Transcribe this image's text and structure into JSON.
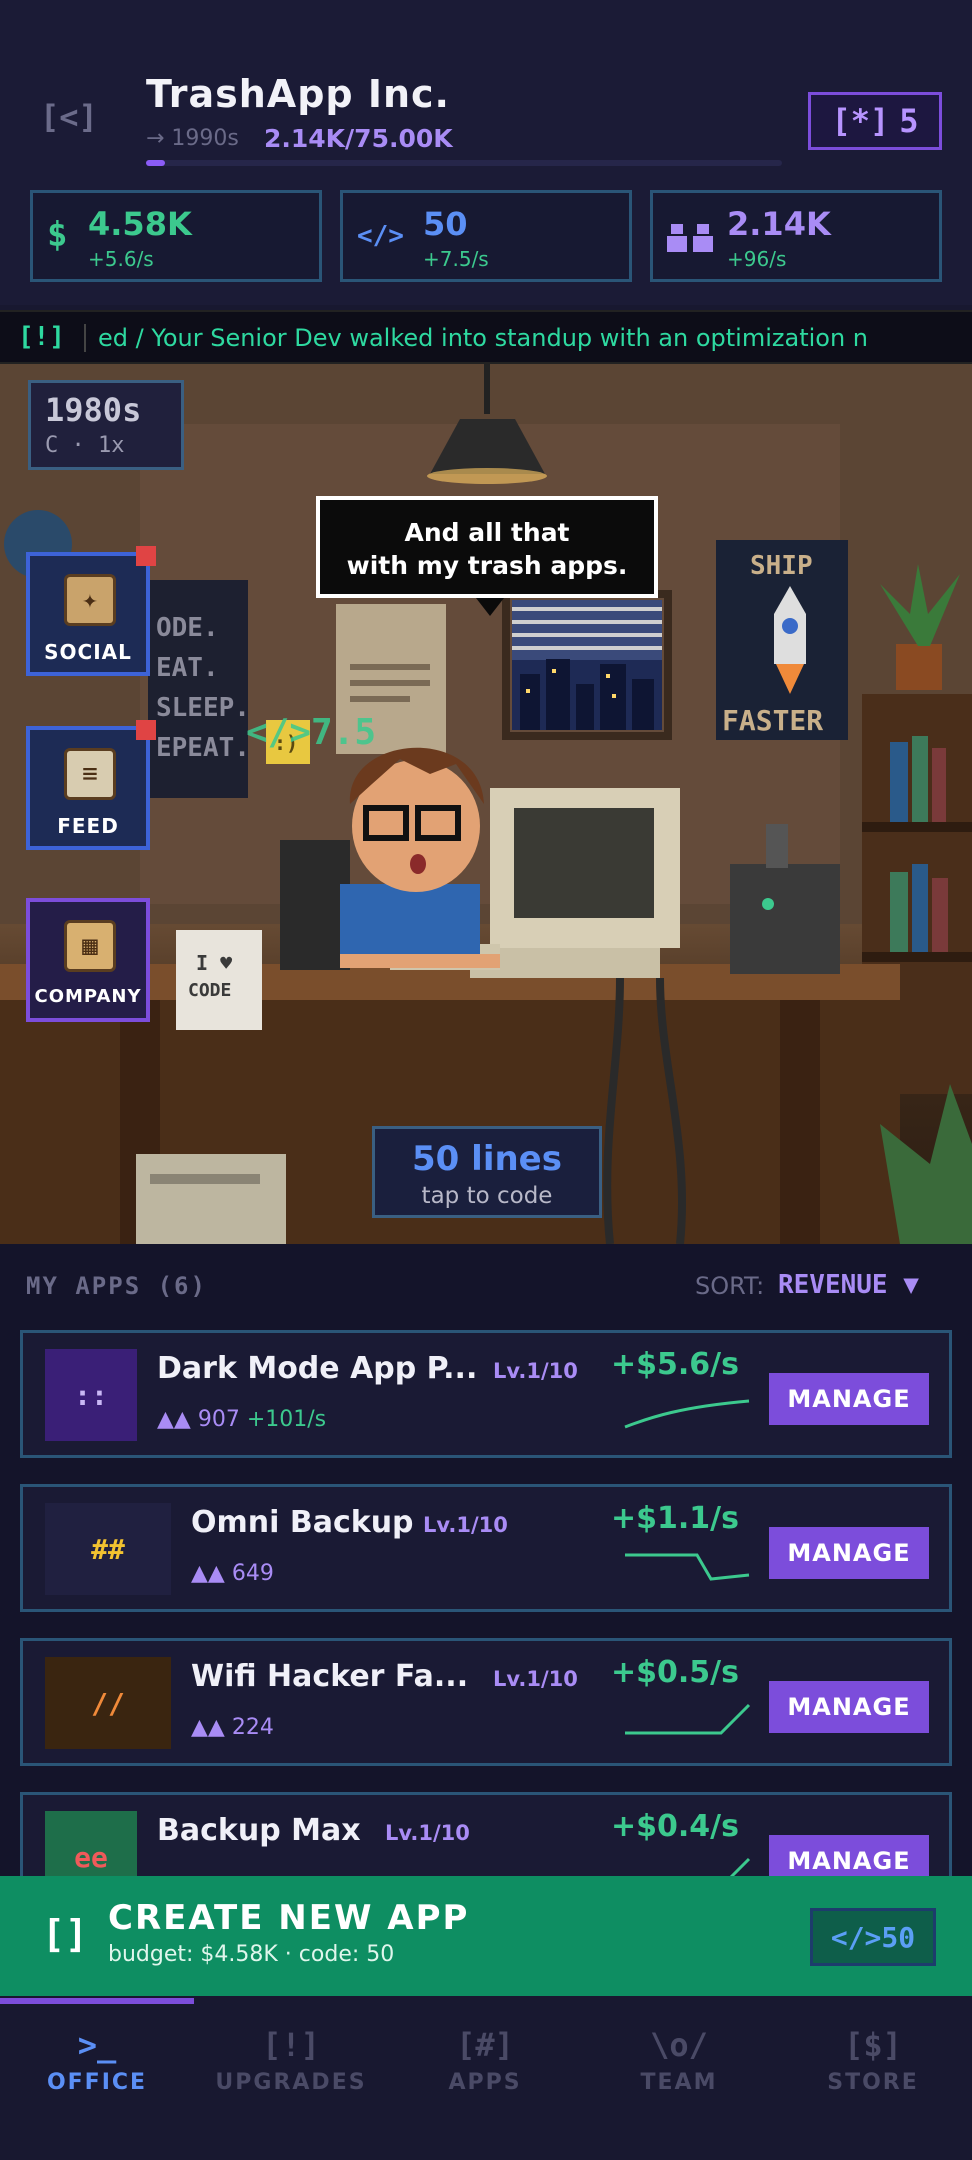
{
  "header": {
    "back_label": "[<]",
    "company_name": "TrashApp Inc.",
    "era_hint": "→ 1990s",
    "users_progress": "2.14K/75.00K",
    "progress_fraction": 0.03,
    "token_icon": "[*]",
    "token_count": "5"
  },
  "stats": [
    {
      "icon": "$",
      "value": "4.58K",
      "rate": "+5.6/s",
      "color": "#3cc98e"
    },
    {
      "icon": "</>",
      "value": "50",
      "rate": "+7.5/s",
      "color": "#5b8ff5"
    },
    {
      "icon": "users-icon",
      "value": "2.14K",
      "rate": "+96/s",
      "color": "#a98cf5"
    }
  ],
  "ticker": {
    "tag": "[!]",
    "text": "ed  /  Your Senior Dev walked into standup with an optimization n"
  },
  "scene": {
    "era_title": "1980s",
    "era_sub": "C · 1x",
    "speech_line1": "And all that",
    "speech_line2": "with my trash apps.",
    "floater": "</>7.5",
    "side_buttons": [
      {
        "label": "SOCIAL",
        "icon": "social-icon",
        "has_notification": true
      },
      {
        "label": "FEED",
        "icon": "newspaper-icon",
        "has_notification": true
      },
      {
        "label": "COMPANY",
        "icon": "company-building-icon",
        "has_notification": false
      }
    ],
    "code_button_main": "50 lines",
    "code_button_sub": "tap to code"
  },
  "apps": {
    "title": "MY APPS (6)",
    "sort_label": "SORT:",
    "sort_value": "REVENUE ▼",
    "items": [
      {
        "icon_text": "::",
        "icon_bg": "#3a1f77",
        "icon_color": "#c9b8f5",
        "name": "Dark Mode App P...",
        "level": "Lv.1/10",
        "users": "907",
        "growth": "+101/s",
        "revenue": "+$5.6/s",
        "manage": "MANAGE"
      },
      {
        "icon_text": "##",
        "icon_bg": "#202040",
        "icon_color": "#f2c230",
        "name": "Omni Backup",
        "level": "Lv.1/10",
        "users": "649",
        "growth": "",
        "revenue": "+$1.1/s",
        "manage": "MANAGE"
      },
      {
        "icon_text": "//",
        "icon_bg": "#3a2510",
        "icon_color": "#f08a3a",
        "name": "Wifi Hacker Fa...",
        "level": "Lv.1/10",
        "users": "224",
        "growth": "",
        "revenue": "+$0.5/s",
        "manage": "MANAGE"
      },
      {
        "icon_text": "ee",
        "icon_bg": "#1e6e4a",
        "icon_color": "#ef5a5a",
        "name": "Backup Max",
        "level": "Lv.1/10",
        "users": "",
        "growth": "",
        "revenue": "+$0.4/s",
        "manage": "MANAGE"
      }
    ]
  },
  "create": {
    "icon": "[]",
    "title": "CREATE NEW APP",
    "subtitle": "budget: $4.58K · code: 50",
    "cost": "</>50"
  },
  "nav": [
    {
      "glyph": ">_",
      "label": "OFFICE",
      "active": true
    },
    {
      "glyph": "[!]",
      "label": "UPGRADES",
      "active": false
    },
    {
      "glyph": "[#]",
      "label": "APPS",
      "active": false
    },
    {
      "glyph": "\\o/",
      "label": "TEAM",
      "active": false
    },
    {
      "glyph": "[$]",
      "label": "STORE",
      "active": false
    }
  ]
}
